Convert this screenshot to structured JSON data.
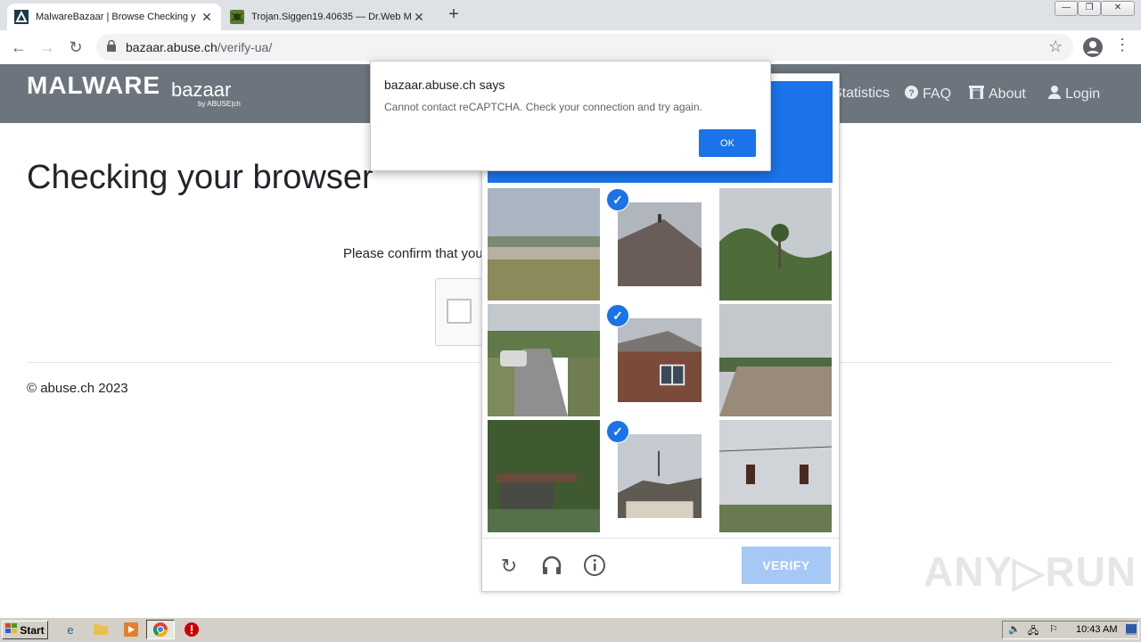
{
  "browser": {
    "tabs": [
      {
        "title": "MalwareBazaar | Browse Checking y",
        "active": true
      },
      {
        "title": "Trojan.Siggen19.40635 — Dr.Web M",
        "active": false
      }
    ],
    "new_tab_glyph": "+",
    "url_host": "bazaar.abuse.ch",
    "url_path": "/verify-ua/"
  },
  "site": {
    "logo_main": "MALWARE",
    "logo_sub": "bazaar",
    "logo_by": "by ABUSE|ch",
    "nav": [
      {
        "label": "Statistics",
        "icon": "chart-icon"
      },
      {
        "label": "FAQ",
        "icon": "question-icon"
      },
      {
        "label": "About",
        "icon": "building-icon"
      },
      {
        "label": "Login",
        "icon": "user-icon"
      }
    ],
    "heading": "Checking your browser",
    "confirm_text": "Please confirm that you",
    "footer": "© abuse.ch 2023"
  },
  "captcha": {
    "verify_label": "VERIFY",
    "selected_tiles": [
      1,
      4,
      7
    ]
  },
  "dialog": {
    "title": "bazaar.abuse.ch says",
    "message": "Cannot contact reCAPTCHA. Check your connection and try again.",
    "ok_label": "OK"
  },
  "watermark": "ANY▷RUN",
  "taskbar": {
    "start_label": "Start",
    "clock": "10:43 AM"
  },
  "colors": {
    "header_bg": "#6c757d",
    "accent": "#1a73e8"
  }
}
